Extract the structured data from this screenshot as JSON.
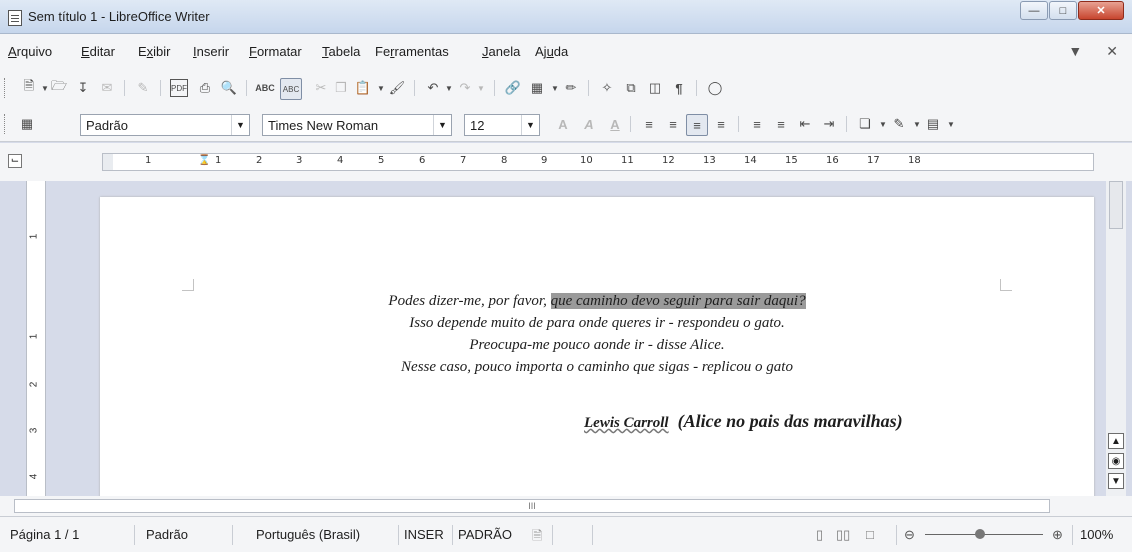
{
  "window": {
    "title": "Sem título 1 - LibreOffice Writer"
  },
  "menu": [
    {
      "pre": "",
      "ul": "A",
      "post": "rquivo"
    },
    {
      "pre": "",
      "ul": "E",
      "post": "ditar"
    },
    {
      "pre": "E",
      "ul": "x",
      "post": "ibir"
    },
    {
      "pre": "",
      "ul": "I",
      "post": "nserir"
    },
    {
      "pre": "",
      "ul": "F",
      "post": "ormatar"
    },
    {
      "pre": "",
      "ul": "T",
      "post": "abela"
    },
    {
      "pre": "Fe",
      "ul": "r",
      "post": "ramentas"
    },
    {
      "pre": "",
      "ul": "J",
      "post": "anela"
    },
    {
      "pre": "Aj",
      "ul": "u",
      "post": "da"
    }
  ],
  "formatting": {
    "style": "Padrão",
    "font": "Times New Roman",
    "size": "12"
  },
  "ruler": {
    "ticks": [
      "1",
      "1",
      "2",
      "3",
      "4",
      "5",
      "6",
      "7",
      "8",
      "9",
      "10",
      "11",
      "12",
      "13",
      "14",
      "15",
      "16",
      "17",
      "18"
    ],
    "vticks": [
      "1",
      "1",
      "2",
      "3",
      "4"
    ]
  },
  "document": {
    "line1_plain": "Podes dizer-me, por favor, ",
    "line1_highlight": "que caminho devo seguir para sair daqui?",
    "line2": "Isso depende muito de para onde queres ir - respondeu o gato.",
    "line3": "Preocupa-me pouco aonde ir - disse Alice.",
    "line4": "Nesse caso, pouco importa o caminho que sigas - replicou o gato",
    "author_name": "Lewis Carroll",
    "author_work": "(Alice no pais das maravilhas)"
  },
  "hscroll_label": "III",
  "status": {
    "page": "Página 1 / 1",
    "style": "Padrão",
    "language": "Português (Brasil)",
    "insert_mode": "INSER",
    "selection_mode": "PADRÃO",
    "zoom": "100%"
  }
}
